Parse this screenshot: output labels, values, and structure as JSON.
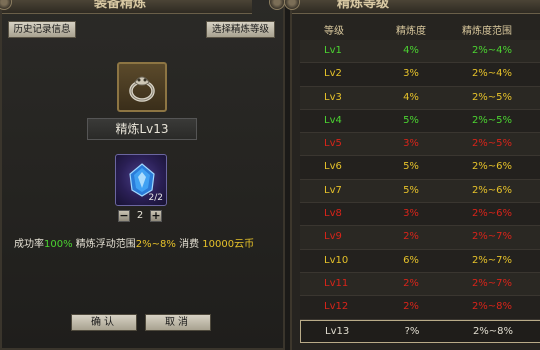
{
  "left_panel": {
    "title": "装备精炼",
    "history_button": "历史记录信息",
    "select_level_button": "选择精炼等级",
    "item_icon": "ring-icon",
    "level_label": "精炼Lv13",
    "stone_icon": "refine-stone-icon",
    "stone_count": "2/2",
    "minus_label": "−",
    "quantity": "2",
    "plus_label": "+",
    "info": {
      "success_label": "成功率",
      "success_value": "100%",
      "range_label": "精炼浮动范围",
      "range_value": "2%~8%",
      "cost_label": "消费",
      "cost_value": "10000云币"
    },
    "confirm_button": "确认",
    "cancel_button": "取消"
  },
  "right_panel": {
    "title": "精炼等级",
    "headers": {
      "level": "等级",
      "degree": "精炼度",
      "range": "精炼度范围"
    },
    "rows": [
      {
        "level": "Lv1",
        "degree": "4%",
        "range": "2%~4%",
        "color": "#4bd431"
      },
      {
        "level": "Lv2",
        "degree": "3%",
        "range": "2%~4%",
        "color": "#e6c22a"
      },
      {
        "level": "Lv3",
        "degree": "4%",
        "range": "2%~5%",
        "color": "#e6c22a"
      },
      {
        "level": "Lv4",
        "degree": "5%",
        "range": "2%~5%",
        "color": "#4bd431"
      },
      {
        "level": "Lv5",
        "degree": "3%",
        "range": "2%~5%",
        "color": "#d8241a"
      },
      {
        "level": "Lv6",
        "degree": "5%",
        "range": "2%~6%",
        "color": "#e6c22a"
      },
      {
        "level": "Lv7",
        "degree": "5%",
        "range": "2%~6%",
        "color": "#e6c22a"
      },
      {
        "level": "Lv8",
        "degree": "3%",
        "range": "2%~6%",
        "color": "#d8241a"
      },
      {
        "level": "Lv9",
        "degree": "2%",
        "range": "2%~7%",
        "color": "#d8241a"
      },
      {
        "level": "Lv10",
        "degree": "6%",
        "range": "2%~7%",
        "color": "#e6c22a"
      },
      {
        "level": "Lv11",
        "degree": "2%",
        "range": "2%~7%",
        "color": "#d8241a"
      },
      {
        "level": "Lv12",
        "degree": "2%",
        "range": "2%~8%",
        "color": "#d8241a"
      },
      {
        "level": "Lv13",
        "degree": "?%",
        "range": "2%~8%",
        "color": "#e0dccf",
        "selected": true
      }
    ]
  }
}
